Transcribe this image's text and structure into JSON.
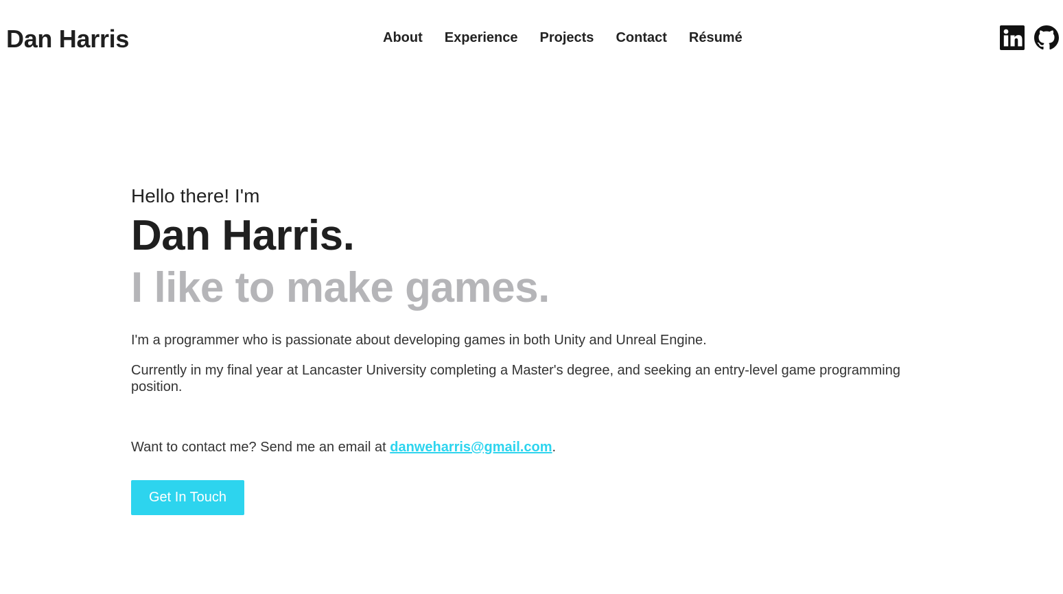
{
  "header": {
    "site_title": "Dan Harris",
    "nav": [
      {
        "label": "About"
      },
      {
        "label": "Experience"
      },
      {
        "label": "Projects"
      },
      {
        "label": "Contact"
      },
      {
        "label": "Résumé"
      }
    ],
    "social": [
      {
        "icon": "linkedin-icon"
      },
      {
        "icon": "github-icon"
      }
    ]
  },
  "hero": {
    "greeting": "Hello there! I'm",
    "name": "Dan Harris.",
    "tagline": "I like to make games.",
    "paragraphs": [
      "I'm a programmer who is passionate about developing games in both Unity and Unreal Engine.",
      "Currently in my final year at Lancaster University completing a Master's degree, and seeking an entry-level game programming position."
    ],
    "contact_prefix": "Want to contact me? Send me an email at ",
    "email": "danweharris@gmail.com",
    "contact_suffix": ".",
    "button_label": "Get In Touch"
  },
  "colors": {
    "accent": "#2dd4ee",
    "tagline": "#b5b5b8",
    "text": "#222222"
  }
}
